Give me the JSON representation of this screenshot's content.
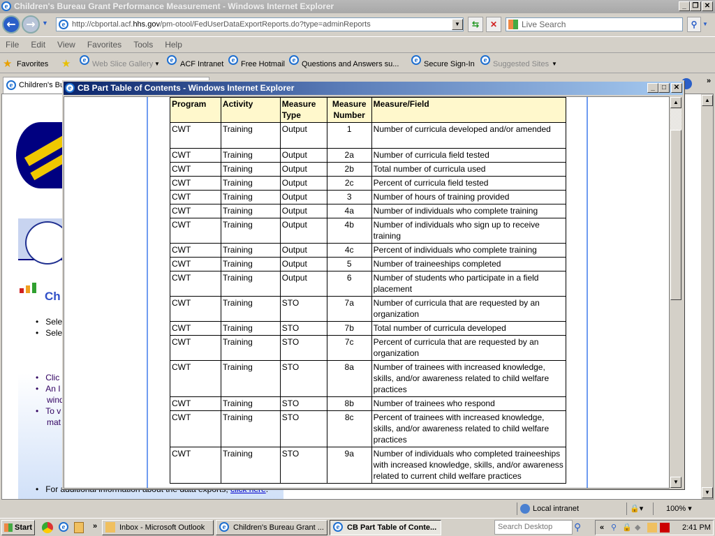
{
  "browser": {
    "title": "Children's Bureau Grant Performance Measurement - Windows Internet Explorer",
    "url_prefix": "http://cbportal.acf.",
    "url_domain": "hhs.gov",
    "url_suffix": "/pm-otool/FedUserDataExportReports.do?type=adminReports",
    "search_placeholder": "Live Search",
    "menu": [
      "File",
      "Edit",
      "View",
      "Favorites",
      "Tools",
      "Help"
    ],
    "favorites_label": "Favorites",
    "favorites": [
      "Web Slice Gallery",
      "ACF Intranet",
      "Free Hotmail",
      "Questions and Answers su...",
      "Secure Sign-In",
      "Suggested Sites"
    ],
    "tab_label": "Children's Bu",
    "page_heading": "Ch",
    "bullets": [
      "Sele",
      "Sele",
      "Clic",
      "An I",
      "wind",
      "To v",
      "mat"
    ],
    "footer_text": "For additional information about the data exports,",
    "footer_link": "click here",
    "status": {
      "zone": "Local intranet",
      "zoom": "100%"
    }
  },
  "popup": {
    "title": "CB Part Table of Contents - Windows Internet Explorer",
    "headers": [
      "Program",
      "Activity",
      "Measure Type",
      "Measure Number",
      "Measure/Field"
    ],
    "rows": [
      [
        "CWT",
        "Training",
        "Output",
        "1",
        "Number of curricula developed and/or amended"
      ],
      [
        "CWT",
        "Training",
        "Output",
        "2a",
        "Number of curricula field tested"
      ],
      [
        "CWT",
        "Training",
        "Output",
        "2b",
        "Total number of curricula used"
      ],
      [
        "CWT",
        "Training",
        "Output",
        "2c",
        "Percent of curricula field tested"
      ],
      [
        "CWT",
        "Training",
        "Output",
        "3",
        "Number of hours of training provided"
      ],
      [
        "CWT",
        "Training",
        "Output",
        "4a",
        "Number of individuals who complete training"
      ],
      [
        "CWT",
        "Training",
        "Output",
        "4b",
        "Number of individuals who sign up to receive training"
      ],
      [
        "CWT",
        "Training",
        "Output",
        "4c",
        "Percent of individuals who complete training"
      ],
      [
        "CWT",
        "Training",
        "Output",
        "5",
        "Number of traineeships completed"
      ],
      [
        "CWT",
        "Training",
        "Output",
        "6",
        "Number of students who participate in a field placement"
      ],
      [
        "CWT",
        "Training",
        "STO",
        "7a",
        "Number of curricula that are requested by an organization"
      ],
      [
        "CWT",
        "Training",
        "STO",
        "7b",
        "Total number of curricula developed"
      ],
      [
        "CWT",
        "Training",
        "STO",
        "7c",
        "Percent of curricula that are requested by an organization"
      ],
      [
        "CWT",
        "Training",
        "STO",
        "8a",
        "Number of trainees with increased knowledge, skills, and/or awareness related to child welfare practices"
      ],
      [
        "CWT",
        "Training",
        "STO",
        "8b",
        "Number of trainees who respond"
      ],
      [
        "CWT",
        "Training",
        "STO",
        "8c",
        "Percent of trainees with increased knowledge, skills, and/or awareness related to child welfare practices"
      ],
      [
        "CWT",
        "Training",
        "STO",
        "9a",
        "Number of individuals who completed traineeships with increased knowledge, skills, and/or awareness related to current child welfare practices"
      ]
    ]
  },
  "taskbar": {
    "start": "Start",
    "tasks": [
      "Inbox - Microsoft Outlook",
      "Children's Bureau Grant ...",
      "CB Part Table of Conte..."
    ],
    "search_placeholder": "Search Desktop",
    "clock": "2:41 PM"
  }
}
